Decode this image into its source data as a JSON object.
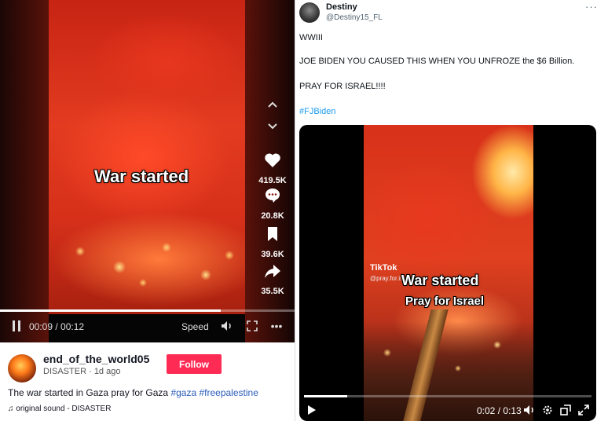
{
  "tiktok": {
    "video_caption": "War started",
    "actions": {
      "likes": "419.5K",
      "comments": "20.8K",
      "bookmarks": "39.6K",
      "shares": "35.5K"
    },
    "player": {
      "current_time": "00:09",
      "duration": "00:12",
      "progress_fraction": 0.75,
      "speed_label": "Speed"
    },
    "author": {
      "username": "end_of_the_world05",
      "nickname": "DISASTER",
      "posted": "1d ago"
    },
    "follow_label": "Follow",
    "description": {
      "text": "The war started in Gaza pray for Gaza",
      "hashtags": [
        "#gaza",
        "#freepalestine"
      ]
    },
    "sound": "original sound - DISASTER",
    "colors": {
      "follow_button": "#fe2c55",
      "hashtag": "#2b5db9"
    }
  },
  "tweet": {
    "author": {
      "name": "Destiny",
      "handle": "@Destiny15_FL"
    },
    "lines": [
      "WWIII",
      "JOE BIDEN YOU CAUSED THIS WHEN YOU UNFROZE the $6 Billion.",
      "PRAY FOR ISRAEL!!!!"
    ],
    "hashtag": "#FJBiden",
    "video": {
      "watermark": "TikTok",
      "watermark_user": "@pray.for.israel",
      "caption_line1": "War started",
      "caption_line2": "Pray for Israel",
      "current_time": "0:02",
      "duration": "0:13",
      "time_display": "0:02 / 0:13",
      "progress_fraction": 0.15
    },
    "colors": {
      "hashtag": "#1d9bf0"
    }
  }
}
